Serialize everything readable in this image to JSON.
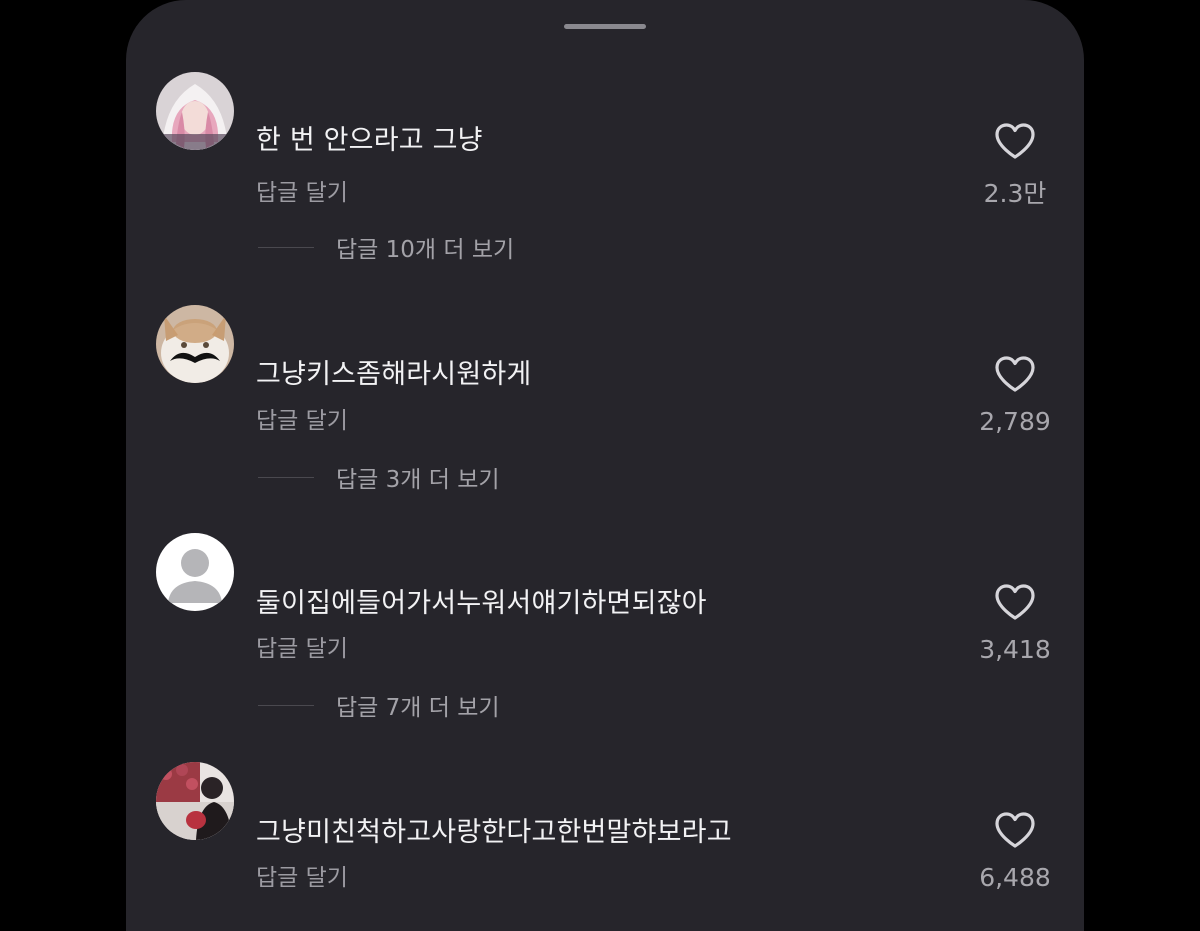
{
  "comments": [
    {
      "text": "한 번 안으라고 그냥",
      "reply_label": "답글 달기",
      "view_replies": "답글 10개 더 보기",
      "likes": "2.3만",
      "avatar": "pink-hair-avatar"
    },
    {
      "text": "그냥키스좀해라시원하게",
      "reply_label": "답글 달기",
      "view_replies": "답글 3개 더 보기",
      "likes": "2,789",
      "avatar": "cat-mustache-avatar"
    },
    {
      "text": "둘이집에들어가서누워서얘기하면되잖아",
      "reply_label": "답글 달기",
      "view_replies": "답글 7개 더 보기",
      "likes": "3,418",
      "avatar": "default-user-avatar"
    },
    {
      "text": "그냥미친척하고사랑한다고한번말햐보라고",
      "reply_label": "답글 달기",
      "likes": "6,488",
      "avatar": "photo-avatar"
    }
  ],
  "colors": {
    "background": "#000000",
    "sheet": "#26252b",
    "text_primary": "#f2f2f4",
    "text_secondary": "#9c9ba2"
  }
}
